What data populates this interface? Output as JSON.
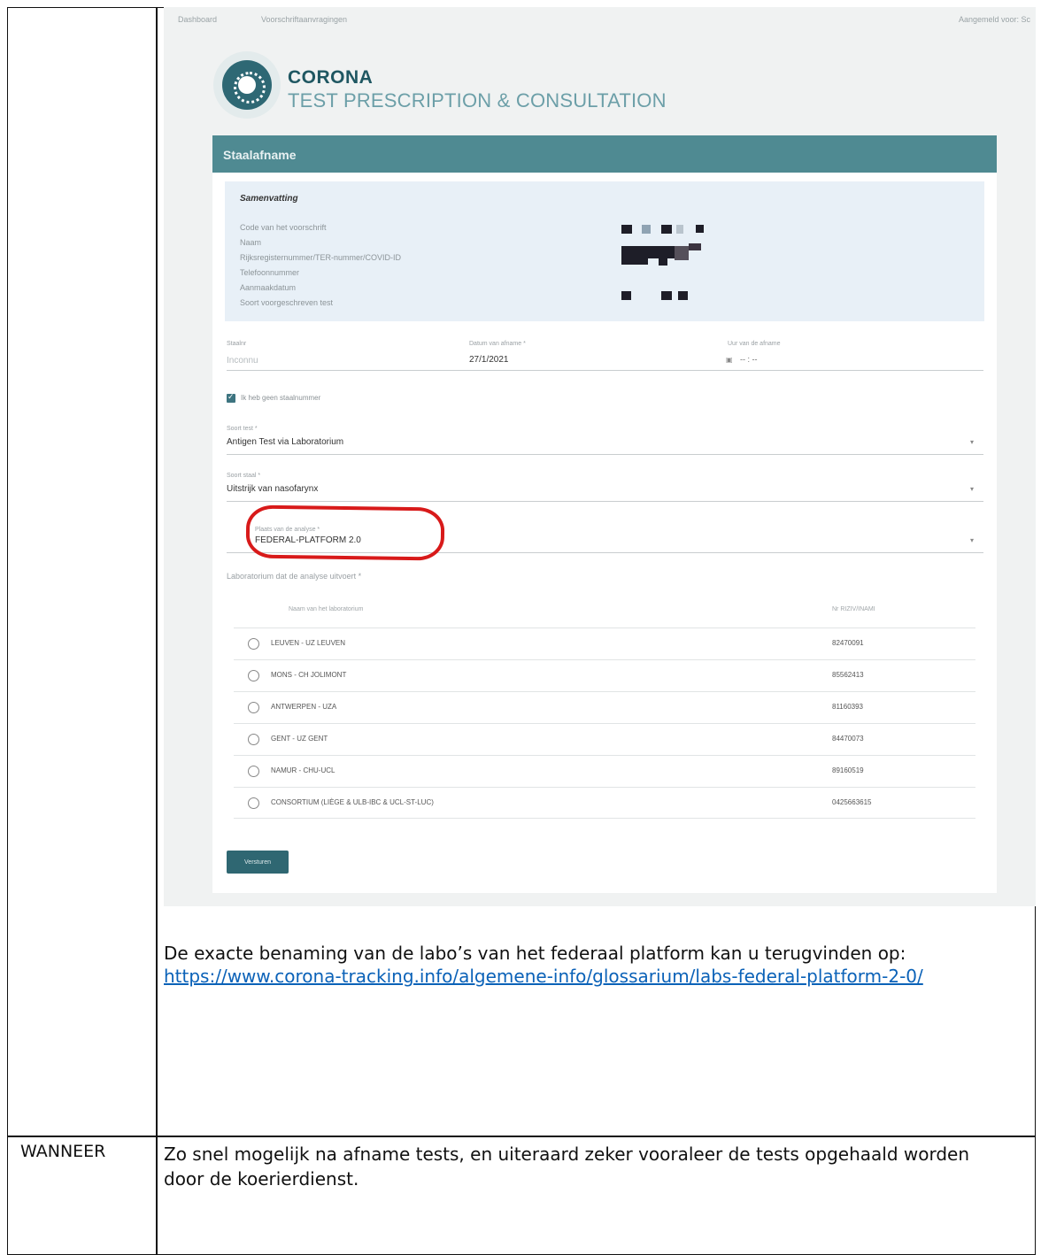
{
  "screenshot": {
    "topbar": {
      "nav_dashboard": "Dashboard",
      "nav_prescriptions": "Voorschriftaanvragingen",
      "logged_in": "Aangemeld voor: Sc"
    },
    "brand": {
      "title": "CORONA",
      "subtitle": "TEST PRESCRIPTION & CONSULTATION"
    },
    "card": {
      "header": "Staalafname",
      "summary": {
        "title": "Samenvatting",
        "labels": [
          "Code van het voorschrift",
          "Naam",
          "Rijksregisternummer/TER-nummer/COVID-ID",
          "Telefoonnummer",
          "Aanmaakdatum",
          "Soort voorgeschreven test"
        ]
      },
      "status": {
        "label": "Staalnr",
        "value": "Inconnu"
      },
      "date": {
        "label": "Datum van afname *",
        "value": "27/1/2021"
      },
      "time": {
        "label": "Uur van de afname",
        "value": "-- : --"
      },
      "no_sample_checkbox": "Ik heb geen staalnummer",
      "test_type": {
        "label": "Soort test *",
        "value": "Antigen Test via Laboratorium"
      },
      "sample_type": {
        "label": "Soort staal *",
        "value": "Uitstrijk van nasofarynx"
      },
      "analysis_place": {
        "label": "Plaats van de analyse *",
        "value": "FEDERAL-PLATFORM 2.0"
      },
      "lab_section_label": "Laboratorium dat de analyse uitvoert *",
      "lab_table": {
        "col_name": "Naam van het laboratorium",
        "col_code": "Nr RIZIV/INAMI",
        "rows": [
          {
            "name": "LEUVEN - UZ LEUVEN",
            "code": "82470091"
          },
          {
            "name": "MONS - CH JOLIMONT",
            "code": "85562413"
          },
          {
            "name": "ANTWERPEN - UZA",
            "code": "81160393"
          },
          {
            "name": "GENT - UZ GENT",
            "code": "84470073"
          },
          {
            "name": "NAMUR - CHU-UCL",
            "code": "89160519"
          },
          {
            "name": "CONSORTIUM (LIÈGE & ULB-IBC & UCL-ST-LUC)",
            "code": "0425663615"
          }
        ]
      },
      "submit_label": "Versturen"
    }
  },
  "document": {
    "paragraph": "De exacte benaming van de labo’s van het federaal platform kan u terugvinden op:",
    "link": "https://www.corona-tracking.info/algemene-info/glossarium/labs-federal-platform-2-0/",
    "row2_label": "WANNEER",
    "row2_text": "Zo snel mogelijk na afname tests, en uiteraard zeker vooraleer de tests opgehaald worden door de koerierdienst."
  },
  "colors": {
    "header_teal": "#4f8a92",
    "summary_bg": "#e8f0f7",
    "annotation_red": "#d81a1a",
    "link_blue": "#0b62b8"
  }
}
